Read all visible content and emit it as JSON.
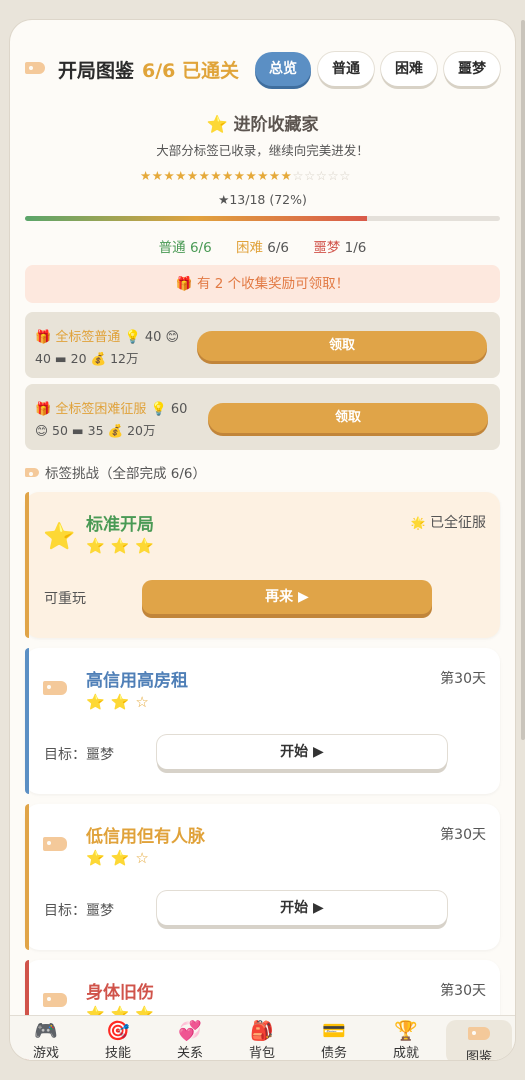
{
  "header": {
    "title": "开局图鉴",
    "progress": "6/6 已通关",
    "tabs": [
      {
        "label": "总览",
        "active": true
      },
      {
        "label": "普通",
        "active": false
      },
      {
        "label": "困难",
        "active": false
      },
      {
        "label": "噩梦",
        "active": false
      }
    ]
  },
  "summary": {
    "rank_title": "进阶收藏家",
    "subtitle": "大部分标签已收录，继续向完美进发！",
    "stars_earned": 13,
    "stars_total": 18,
    "ratio_text": "★13/18 (72%)",
    "progress_fraction": 0.72,
    "difficulty": [
      {
        "name": "普通",
        "value": "6/6"
      },
      {
        "name": "困难",
        "value": "6/6"
      },
      {
        "name": "噩梦",
        "value": "1/6"
      }
    ]
  },
  "banner": {
    "text": "有 2 个收集奖励可领取！"
  },
  "rewards": [
    {
      "name": "全标签普通",
      "line1_cost": "40",
      "line1_tail": "",
      "line2": "40 ▬ 20 💰 12万",
      "button": "领取"
    },
    {
      "name": "全标签困难征服",
      "line1_cost": "60",
      "line1_tail": "",
      "line2": "😊 50 ▬ 35 💰 20万",
      "button": "领取"
    }
  ],
  "section": {
    "title": "标签挑战（全部完成 6/6）"
  },
  "cards": [
    {
      "title": "标准开局",
      "stars": 3,
      "status": "已全征服",
      "note": "可重玩",
      "button": "再来 ▶",
      "color": "#4a9a55",
      "accent": "#e0a448"
    },
    {
      "title": "高信用高房租",
      "stars": 2,
      "status": "第30天",
      "note": "目标：噩梦",
      "button": "开始 ▶",
      "color": "#4f7fb7",
      "accent": "#5b8fc4"
    },
    {
      "title": "低信用但有人脉",
      "stars": 2,
      "status": "第30天",
      "note": "目标：噩梦",
      "button": "开始 ▶",
      "color": "#e0a23a",
      "accent": "#e0a448"
    },
    {
      "title": "身体旧伤",
      "stars": 2,
      "status": "第30天",
      "color": "#d0534a",
      "accent": "#d0534a"
    }
  ],
  "nav": [
    {
      "label": "游戏",
      "icon": "🎮"
    },
    {
      "label": "技能",
      "icon": "🎯"
    },
    {
      "label": "关系",
      "icon": "💞"
    },
    {
      "label": "背包",
      "icon": "🎒"
    },
    {
      "label": "债务",
      "icon": "💳"
    },
    {
      "label": "成就",
      "icon": "🏆"
    },
    {
      "label": "图鉴",
      "icon": "🏷",
      "active": true
    }
  ]
}
